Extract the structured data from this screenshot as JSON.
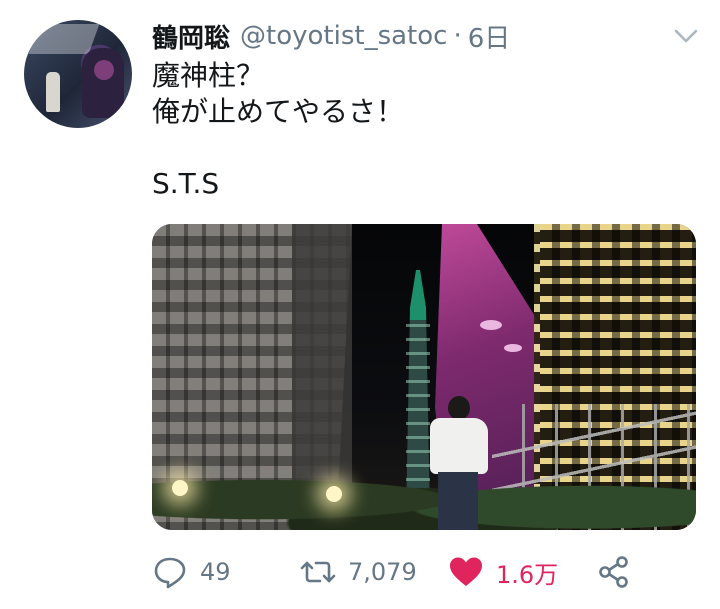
{
  "user": {
    "display_name": "鶴岡聡",
    "handle": "@toyotist_satoc",
    "separator": "·",
    "time": "6日"
  },
  "tweet": {
    "text": "魔神柱？\n俺が止めてやるさ！\n\nS.T.S"
  },
  "actions": {
    "reply_count": "49",
    "retweet_count": "7,079",
    "like_count": "1.6万"
  },
  "icons": {
    "more": "chevron-down-icon",
    "reply": "reply-icon",
    "retweet": "retweet-icon",
    "like": "heart-icon",
    "share": "share-icon"
  },
  "colors": {
    "text": "#14171a",
    "secondary": "#657786",
    "like": "#e0245e"
  }
}
